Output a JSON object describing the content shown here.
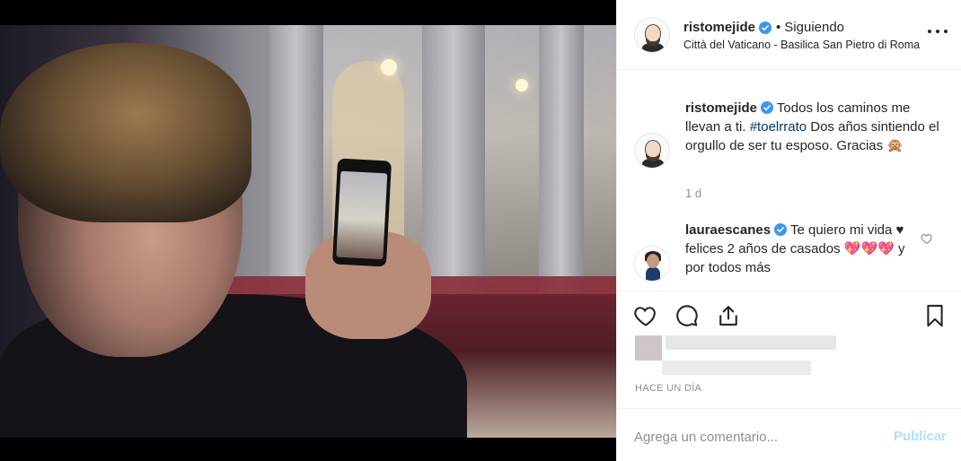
{
  "post": {
    "author": {
      "username": "ristomejide",
      "verified": true,
      "separator": "•",
      "follow_status": "Siguiendo",
      "location": "Città del Vaticano - Basilica San Pietro di Roma",
      "avatar_icon": "profile-avatar-ristomejide"
    },
    "caption": {
      "username": "ristomejide",
      "text_before_tag": " Todos los caminos me llevan a ti. ",
      "hashtag": "#toelrrato",
      "text_after_tag": " Dos años sintiendo el orgullo de ser tu esposo. Gracias 🙊",
      "time": "1 d"
    },
    "comments": [
      {
        "username": "lauraescanes",
        "verified": true,
        "text": " Te quiero mi vida ♥ felices 2 años de casados 💖💖💖 y por todos más",
        "avatar_icon": "profile-avatar-lauraescanes"
      }
    ],
    "actions": {
      "like_icon": "heart-icon",
      "comment_icon": "comment-icon",
      "share_icon": "share-icon",
      "save_icon": "bookmark-icon"
    },
    "timestamp": "HACE UN DÍA",
    "composer": {
      "placeholder": "Agrega un comentario...",
      "post_label": "Publicar"
    },
    "colors": {
      "verified": "#3897f0",
      "hashtag": "#00376b",
      "post_disabled": "#b2dffc",
      "muted": "#8e8e8e"
    }
  }
}
